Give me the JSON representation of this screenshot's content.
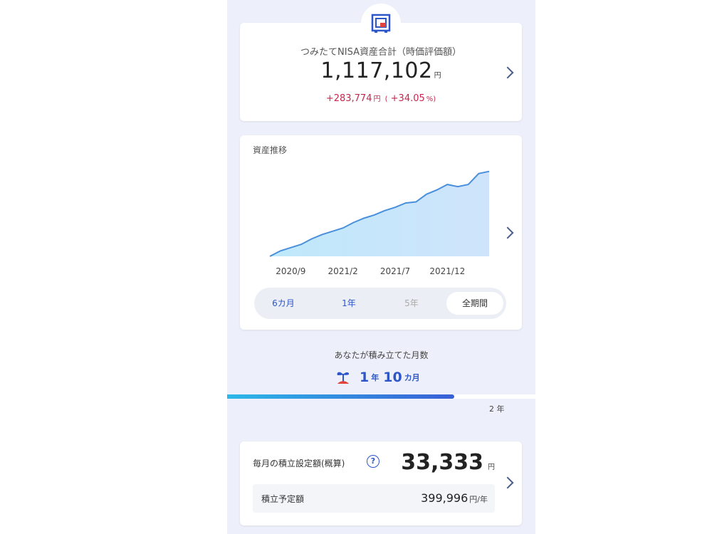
{
  "summary": {
    "title": "つみたてNISA資産合計（時価評価額）",
    "amount": "1,117,102",
    "unit": "円",
    "gain": "+283,774",
    "gain_unit": "円",
    "gain_pct_open": "(",
    "gain_pct": "+34.05",
    "gain_pct_unit": "%)",
    "icon": "safe-icon"
  },
  "chart_card": {
    "title": "資産推移",
    "periods": [
      {
        "label": "6カ月",
        "state": "enabled"
      },
      {
        "label": "1年",
        "state": "enabled"
      },
      {
        "label": "5年",
        "state": "disabled"
      },
      {
        "label": "全期間",
        "state": "selected"
      }
    ]
  },
  "chart_data": {
    "type": "area",
    "tick_labels": [
      "2020/9",
      "2021/2",
      "2021/7",
      "2021/12"
    ],
    "x": [
      "2020/7",
      "2020/8",
      "2020/9",
      "2020/10",
      "2020/11",
      "2020/12",
      "2021/1",
      "2021/2",
      "2021/3",
      "2021/4",
      "2021/5",
      "2021/6",
      "2021/7",
      "2021/8",
      "2021/9",
      "2021/10",
      "2021/11",
      "2021/12",
      "2022/1",
      "2022/2",
      "2022/3",
      "2022/4"
    ],
    "values": [
      0.0,
      0.05,
      0.08,
      0.11,
      0.16,
      0.2,
      0.23,
      0.26,
      0.31,
      0.35,
      0.38,
      0.42,
      0.45,
      0.49,
      0.5,
      0.57,
      0.61,
      0.66,
      0.64,
      0.66,
      0.76,
      0.78
    ],
    "ylim": [
      0,
      0.85
    ],
    "line_color": "#4a8fdc",
    "fill_color": "#cfe4fb",
    "grid": false
  },
  "months": {
    "label": "あなたが積み立てた月数",
    "years": "1",
    "year_unit": "年",
    "months": "10",
    "month_unit": "カ月",
    "progress": 0.7333,
    "goal": "2 年"
  },
  "monthly": {
    "label": "毎月の積立設定額(概算)",
    "help": "?",
    "amount": "33,333",
    "unit": "円",
    "planned_label": "積立予定額",
    "planned_amount": "399,996",
    "planned_unit": "円/年"
  },
  "colors": {
    "accent": "#2d56c9",
    "gain": "#c7254e",
    "background": "#edf0fa"
  }
}
